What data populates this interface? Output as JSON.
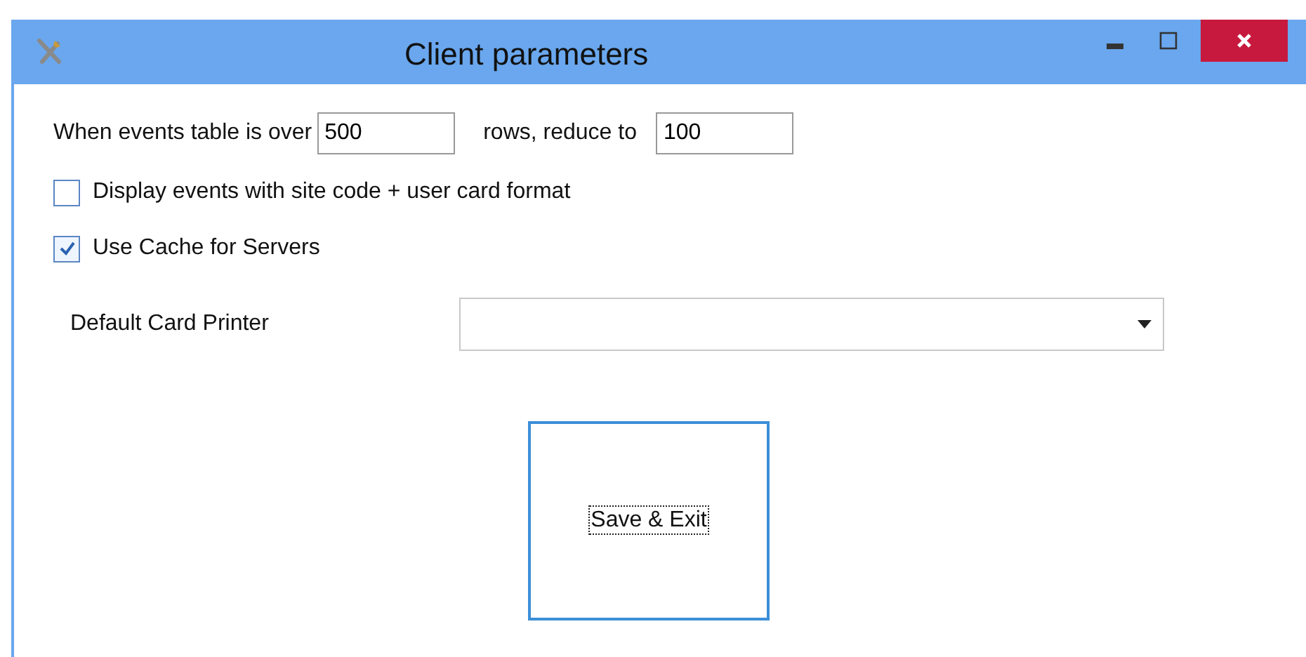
{
  "window": {
    "title": "Client parameters"
  },
  "limits": {
    "prefix": "When events table is over",
    "over_value": "500",
    "middle": "rows, reduce to",
    "reduce_value": "100"
  },
  "options": [
    {
      "label": "Display events with site code + user card format",
      "checked": false
    },
    {
      "label": "Use Cache for Servers",
      "checked": true
    }
  ],
  "printer": {
    "label": "Default Card Printer"
  },
  "buttons": [
    {
      "label": "Save & Exit",
      "focused": true
    }
  ]
}
